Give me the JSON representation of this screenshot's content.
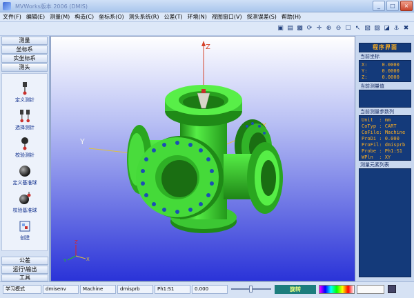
{
  "window": {
    "title": "MVWorks版本 2006 (DMIS)",
    "controls": [
      "_",
      "□",
      "×"
    ]
  },
  "menu": [
    "文件(F)",
    "编辑(E)",
    "测量(M)",
    "构造(C)",
    "坐标系(O)",
    "测头系统(R)",
    "公差(T)",
    "环境(N)",
    "视图窗口(V)",
    "探测误差(S)",
    "帮助(H)"
  ],
  "toolbar": {
    "icons": [
      "save-icon",
      "print-icon",
      "zoom-window-icon",
      "rotate-icon",
      "pan-icon",
      "zoom-in-icon",
      "zoom-out-icon",
      "fit-icon",
      "select-icon",
      "view-front-icon",
      "view-top-icon",
      "view-iso-icon",
      "probe-icon",
      "delete-icon"
    ],
    "glyphs": [
      "▣",
      "▤",
      "▩",
      "⟳",
      "✛",
      "⊕",
      "⊖",
      "☐",
      "↖",
      "▧",
      "▨",
      "◪",
      "⚓",
      "✖"
    ]
  },
  "left_panel": {
    "sections_top": [
      "测量",
      "坐标系",
      "实坐标系",
      "测头"
    ],
    "active_section": "测头",
    "tools": [
      {
        "label": "定义测针",
        "icon": "probe-define-icon"
      },
      {
        "label": "选择测针",
        "icon": "probe-select-icon"
      },
      {
        "label": "校验测针",
        "icon": "probe-calibrate-icon"
      },
      {
        "label": "定义基准球",
        "icon": "sphere-define-icon"
      },
      {
        "label": "校验基准球",
        "icon": "sphere-calibrate-icon"
      },
      {
        "label": "创建",
        "icon": "create-icon"
      }
    ],
    "sections_bottom": [
      "公差",
      "运行\\输出",
      "工具"
    ]
  },
  "viewport": {
    "background_top": "#ffffff",
    "background_bottom": "#2a33d8",
    "part_color": "#36d52c",
    "axis_labels": {
      "z": "Z",
      "x": "X",
      "y": "Y"
    },
    "triad_labels": {
      "z": "Z",
      "x": "X",
      "y": "Y"
    }
  },
  "right_panel": {
    "header": "程序界面",
    "coords_caption": "当前坐标",
    "coords": [
      "X:     0.0000",
      "Y:     0.0000",
      "Z:     0.0000"
    ],
    "measured_caption": "当前测量值",
    "params_caption": "当前测量参数列",
    "params": [
      "Unit  : mm",
      "CoTyp : CART",
      "CoFile: Machine",
      "ProDi : 0.000",
      "ProFil: dmisprb",
      "Probe : Ph1:S1",
      "WPln  : XY"
    ],
    "elements_caption": "测量元素列表"
  },
  "status_bar": {
    "mode": "学习模式",
    "env": "dmisenv",
    "coord": "Machine",
    "probe_file": "dmisprb",
    "probe": "Ph1:S1",
    "value": "0.000",
    "rotate_label": "旋转"
  }
}
